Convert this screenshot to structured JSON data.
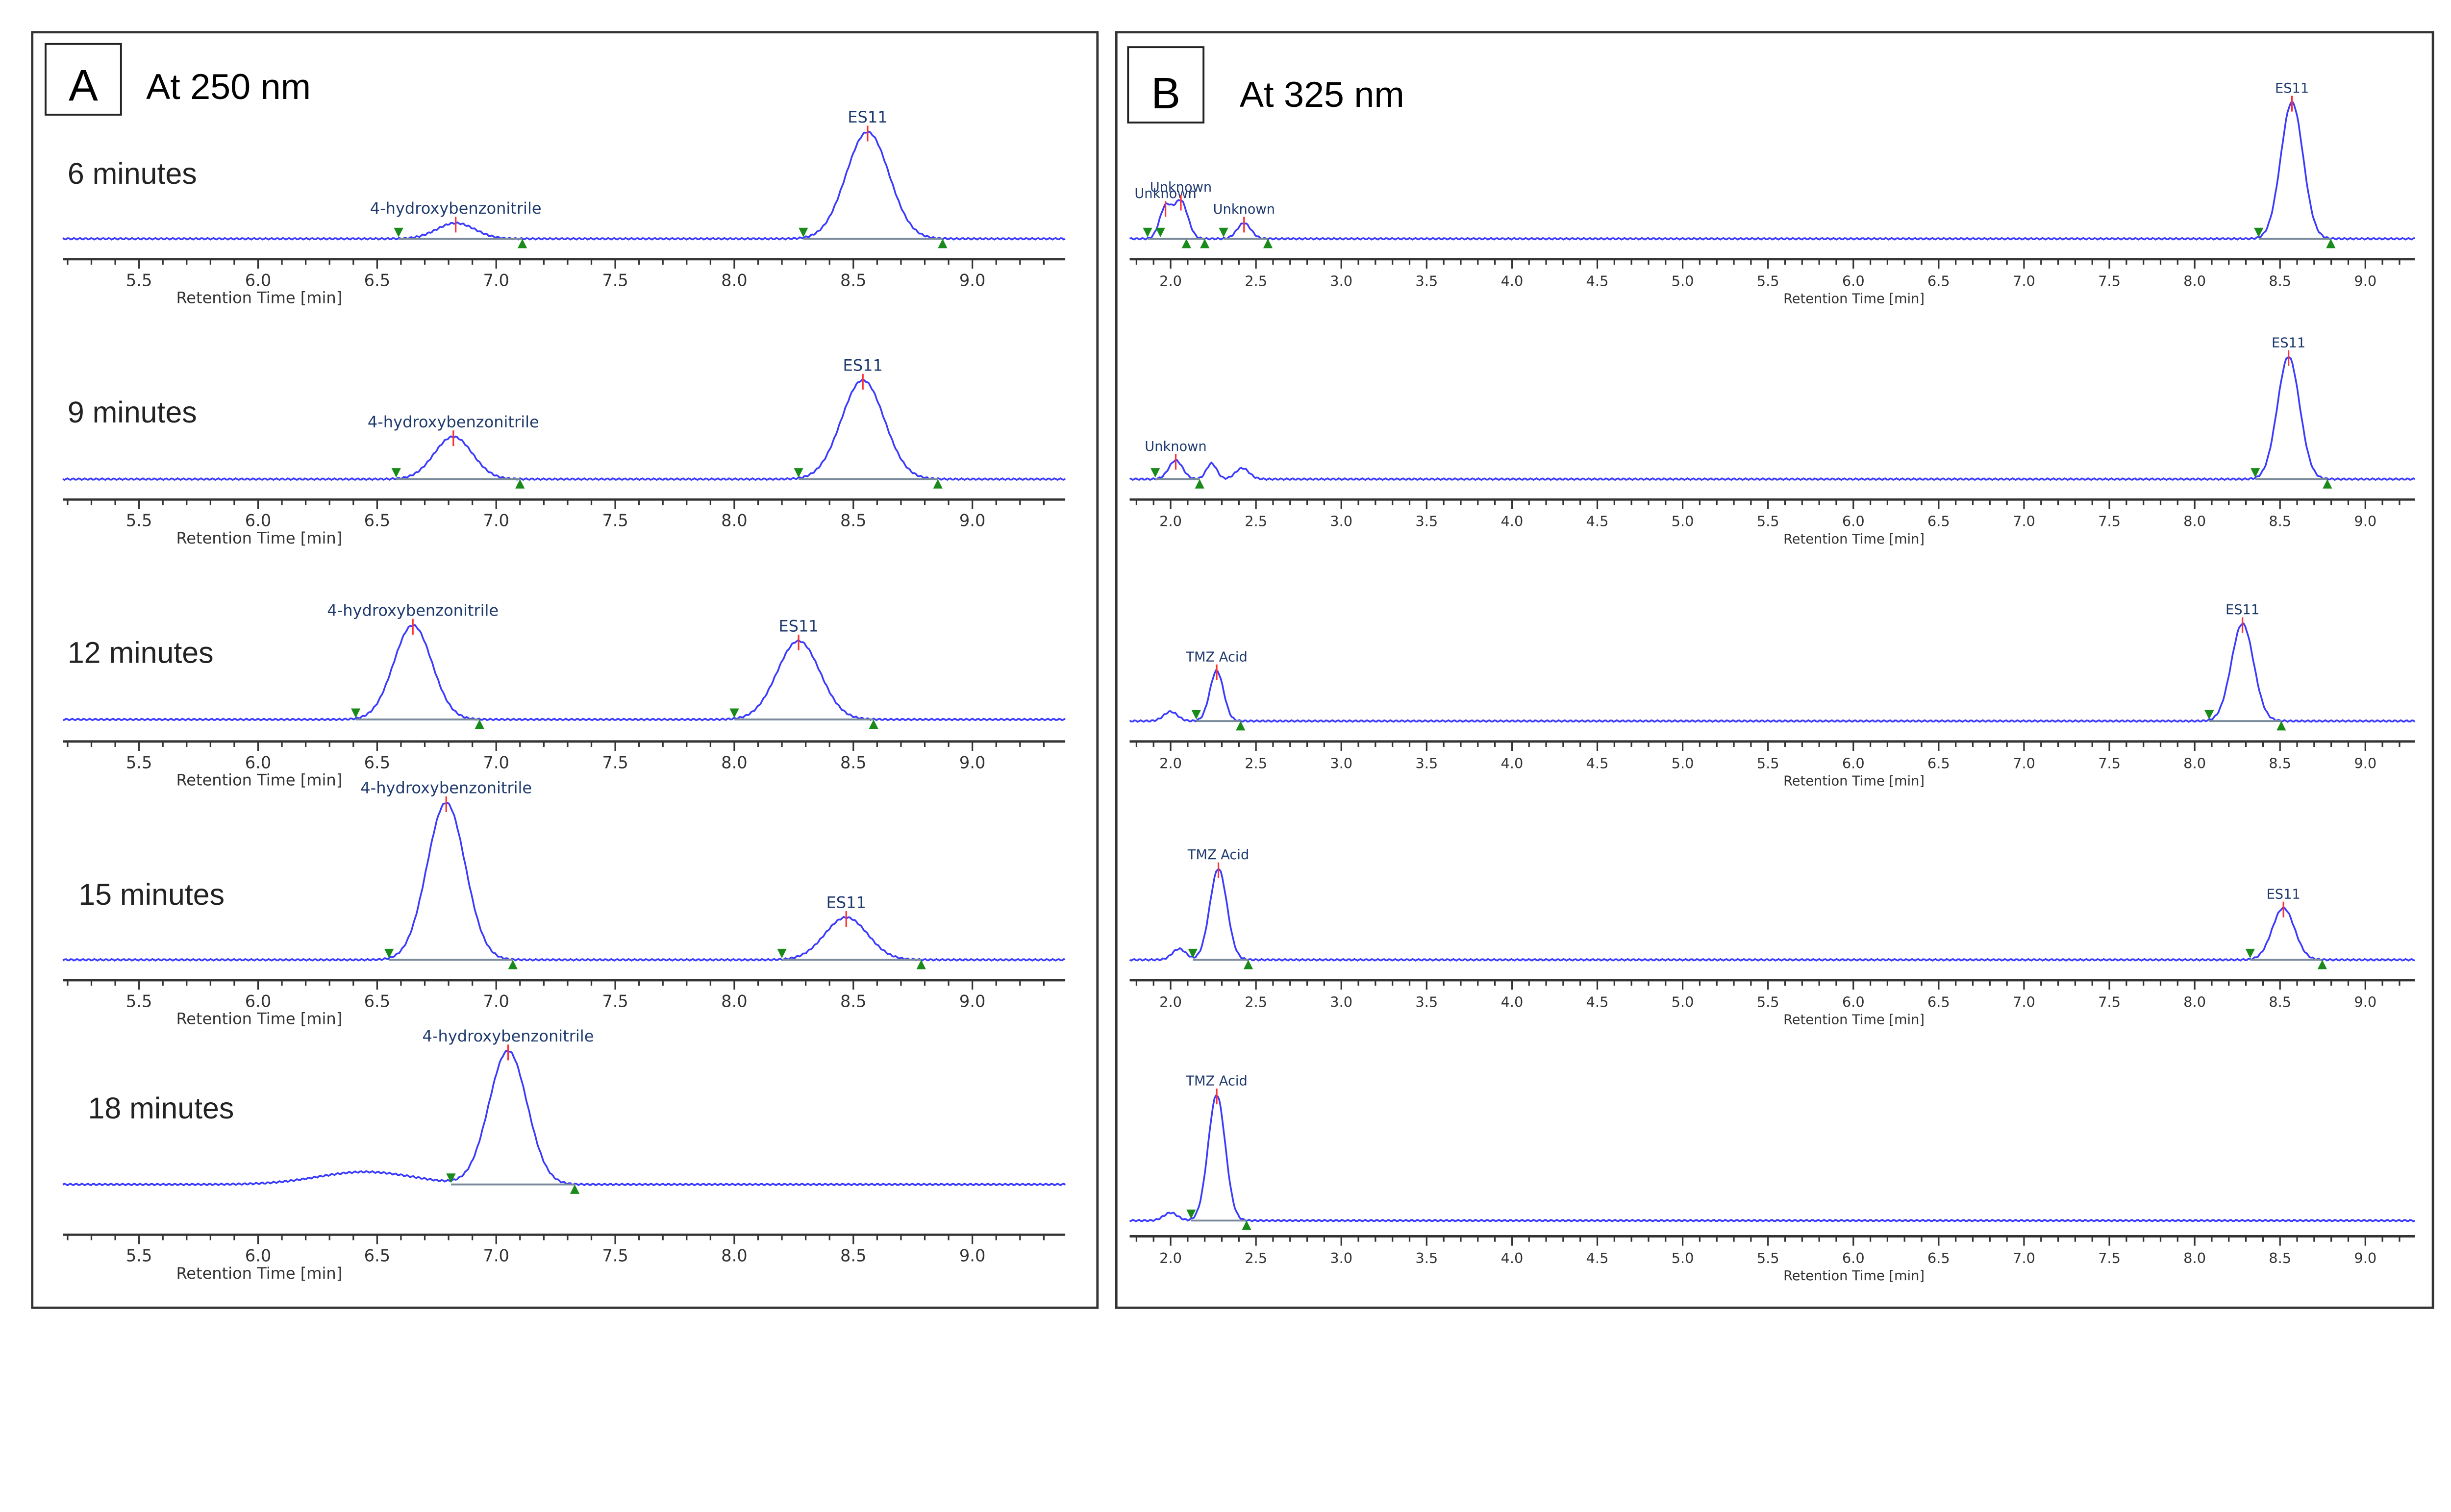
{
  "chart_data": [
    {
      "type": "line",
      "panel_letter": "A",
      "title": "At 250 nm",
      "xlabel": "Retention Time [min]",
      "xlim": [
        5.18,
        9.39
      ],
      "xticks": [
        "5.5",
        "6.0",
        "6.5",
        "7.0",
        "7.5",
        "8.0",
        "8.5",
        "9.0"
      ],
      "intensity_units": "relative",
      "subplots": [
        {
          "label": "6 minutes",
          "peaks": [
            {
              "name": "4-hydroxybenzonitrile",
              "rt": 6.83,
              "height": 10,
              "sigma": 0.08
            },
            {
              "name": "ES11",
              "rt": 8.56,
              "height": 68,
              "sigma": 0.09
            }
          ]
        },
        {
          "label": "9 minutes",
          "peaks": [
            {
              "name": "4-hydroxybenzonitrile",
              "rt": 6.82,
              "height": 27,
              "sigma": 0.08
            },
            {
              "name": "ES11",
              "rt": 8.54,
              "height": 63,
              "sigma": 0.09
            }
          ]
        },
        {
          "label": "12 minutes",
          "peaks": [
            {
              "name": "4-hydroxybenzonitrile",
              "rt": 6.65,
              "height": 60,
              "sigma": 0.08
            },
            {
              "name": "ES11",
              "rt": 8.27,
              "height": 50,
              "sigma": 0.09
            }
          ]
        },
        {
          "label": "15 minutes",
          "peaks": [
            {
              "name": "4-hydroxybenzonitrile",
              "rt": 6.79,
              "height": 100,
              "sigma": 0.08
            },
            {
              "name": "ES11",
              "rt": 8.47,
              "height": 27,
              "sigma": 0.09
            }
          ]
        },
        {
          "label": "18 minutes",
          "peaks": [
            {
              "name": "",
              "rt": 6.45,
              "height": 8,
              "sigma": 0.2
            },
            {
              "name": "4-hydroxybenzonitrile",
              "rt": 7.05,
              "height": 85,
              "sigma": 0.08
            }
          ]
        }
      ]
    },
    {
      "type": "line",
      "panel_letter": "B",
      "title": "At 325 nm",
      "xlabel": "Retention Time [min]",
      "xlim": [
        1.76,
        9.29
      ],
      "xticks": [
        "2.0",
        "2.5",
        "3.0",
        "3.5",
        "4.0",
        "4.5",
        "5.0",
        "5.5",
        "6.0",
        "6.5",
        "7.0",
        "7.5",
        "8.0",
        "8.5",
        "9.0"
      ],
      "intensity_units": "relative",
      "subplots": [
        {
          "label": "",
          "peaks": [
            {
              "name": "Unknown",
              "rt": 1.97,
              "height": 20,
              "sigma": 0.035
            },
            {
              "name": "Unknown",
              "rt": 2.06,
              "height": 24,
              "sigma": 0.04
            },
            {
              "name": "Unknown",
              "rt": 2.43,
              "height": 10,
              "sigma": 0.04
            },
            {
              "name": "ES11",
              "rt": 8.57,
              "height": 87,
              "sigma": 0.065
            }
          ]
        },
        {
          "label": "",
          "peaks": [
            {
              "name": "Unknown",
              "rt": 2.03,
              "height": 12,
              "sigma": 0.04
            },
            {
              "name": "",
              "rt": 2.24,
              "height": 10,
              "sigma": 0.03
            },
            {
              "name": "",
              "rt": 2.42,
              "height": 7,
              "sigma": 0.04
            },
            {
              "name": "ES11",
              "rt": 8.55,
              "height": 78,
              "sigma": 0.065
            }
          ]
        },
        {
          "label": "",
          "peaks": [
            {
              "name": "",
              "rt": 2.0,
              "height": 6,
              "sigma": 0.04
            },
            {
              "name": "TMZ Acid",
              "rt": 2.27,
              "height": 32,
              "sigma": 0.04
            },
            {
              "name": "ES11",
              "rt": 8.28,
              "height": 62,
              "sigma": 0.065
            }
          ]
        },
        {
          "label": "",
          "peaks": [
            {
              "name": "",
              "rt": 2.05,
              "height": 7,
              "sigma": 0.04
            },
            {
              "name": "TMZ Acid",
              "rt": 2.28,
              "height": 58,
              "sigma": 0.05
            },
            {
              "name": "ES11",
              "rt": 8.52,
              "height": 33,
              "sigma": 0.065
            }
          ]
        },
        {
          "label": "",
          "peaks": [
            {
              "name": "",
              "rt": 2.0,
              "height": 5,
              "sigma": 0.04
            },
            {
              "name": "TMZ Acid",
              "rt": 2.27,
              "height": 80,
              "sigma": 0.05
            }
          ]
        }
      ]
    }
  ],
  "colors": {
    "trace": "#3a3aff",
    "label": "#1f3a6e",
    "apex": "#ff3030",
    "marker": "#1a8a1a",
    "baseline": "#7a8a9a"
  }
}
